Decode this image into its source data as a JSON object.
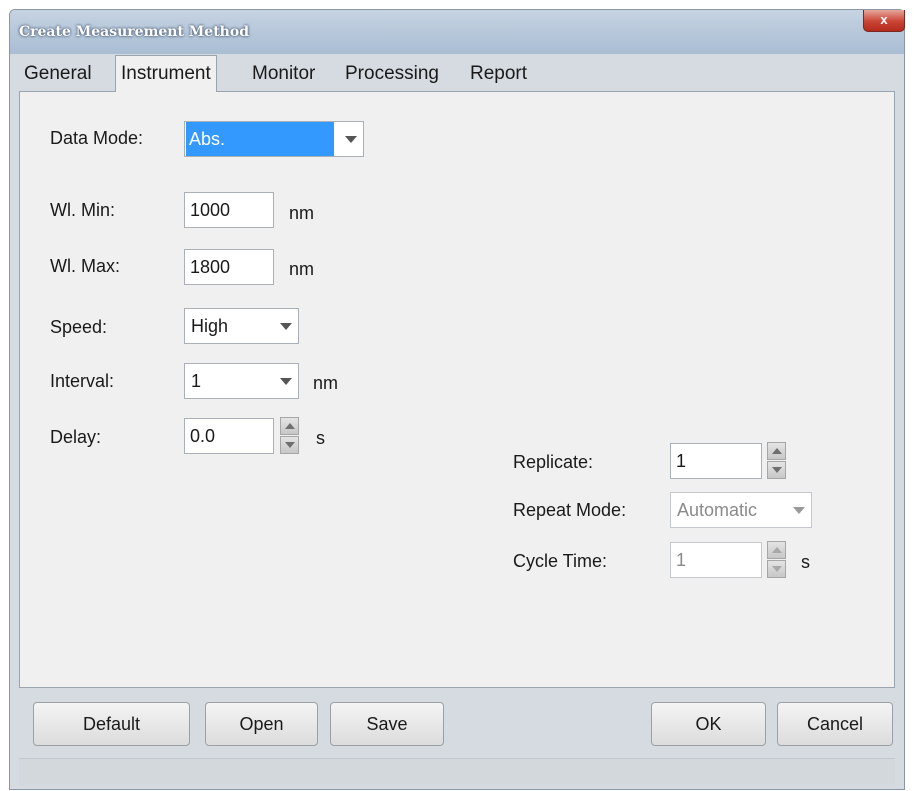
{
  "window": {
    "title": "Create Measurement Method",
    "close_label": "x"
  },
  "tabs": [
    {
      "label": "General"
    },
    {
      "label": "Instrument"
    },
    {
      "label": "Monitor"
    },
    {
      "label": "Processing"
    },
    {
      "label": "Report"
    }
  ],
  "active_tab": "Instrument",
  "form": {
    "data_mode": {
      "label": "Data Mode:",
      "value": "Abs."
    },
    "wl_min": {
      "label": "Wl. Min:",
      "value": "1000",
      "unit": "nm"
    },
    "wl_max": {
      "label": "Wl. Max:",
      "value": "1800",
      "unit": "nm"
    },
    "speed": {
      "label": "Speed:",
      "value": "High"
    },
    "interval": {
      "label": "Interval:",
      "value": "1",
      "unit": "nm"
    },
    "delay": {
      "label": "Delay:",
      "value": "0.0",
      "unit": "s"
    },
    "replicate": {
      "label": "Replicate:",
      "value": "1"
    },
    "repeat_mode": {
      "label": "Repeat Mode:",
      "value": "Automatic"
    },
    "cycle_time": {
      "label": "Cycle Time:",
      "value": "1",
      "unit": "s"
    }
  },
  "buttons": {
    "default": "Default",
    "open": "Open",
    "save": "Save",
    "ok": "OK",
    "cancel": "Cancel"
  },
  "colors": {
    "selection": "#3399ff",
    "titlebar": "#a9bdd3",
    "close": "#c94434"
  }
}
